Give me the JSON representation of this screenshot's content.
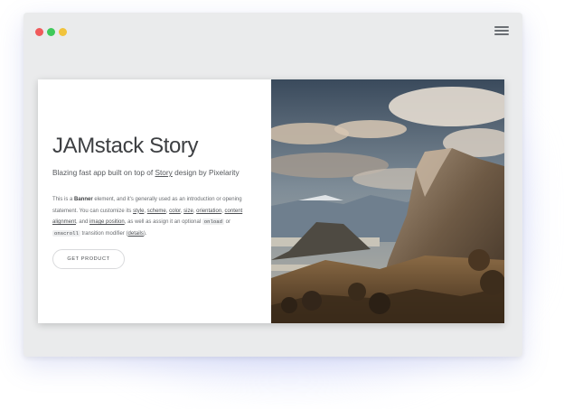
{
  "window": {
    "controls": [
      "close",
      "minimize",
      "maximize"
    ],
    "menu_icon": "hamburger-icon"
  },
  "banner": {
    "title": "JAMstack Story",
    "subtitle": {
      "before": "Blazing fast app built on top of ",
      "link": "Story",
      "after": " design by Pixelarity"
    },
    "description": {
      "p1": "This is a ",
      "bold": "Banner",
      "p2": " element, and it's generally used as an introduction or opening statement. You can customize its ",
      "links": [
        "style",
        "scheme",
        "color",
        "size",
        "orientation",
        "content alignment",
        "image position"
      ],
      "sep": ", ",
      "and": ", and ",
      "p3": ", as well as assign it an optional ",
      "code1": "onload",
      "or": " or ",
      "code2": "onscroll",
      "p4": " transition modifier (",
      "details": "details",
      "p5": ")."
    },
    "button_label": "GET PRODUCT",
    "image": "landscape photo of mountain cliff, valley and clouds"
  },
  "colors": {
    "window_bg": "#eaebec",
    "dot_red": "#f05a5b",
    "dot_green": "#3fc95a",
    "dot_yellow": "#f1c33c",
    "glow": "#c8d0fa"
  }
}
